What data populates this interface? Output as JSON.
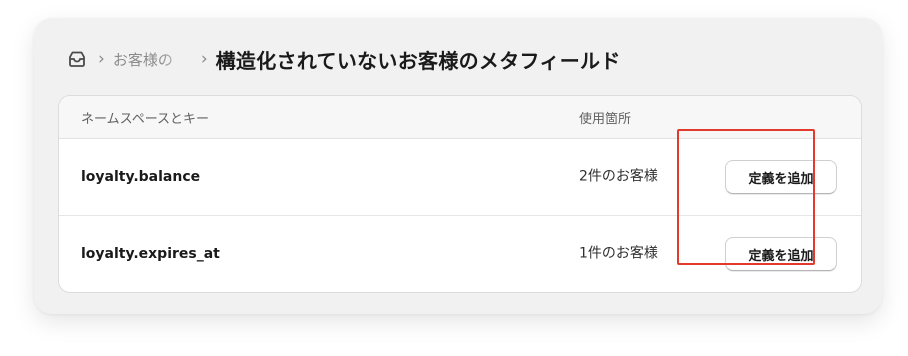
{
  "breadcrumb": {
    "icon": "inbox-tray-icon",
    "parent_label": "お客様の",
    "separator": "›"
  },
  "page": {
    "title": "構造化されていないお客様のメタフィールド"
  },
  "table": {
    "headers": {
      "namespace_key": "ネームスペースとキー",
      "usage": "使用箇所"
    },
    "rows": [
      {
        "namespace_key": "loyalty.balance",
        "usage": "2件のお客様",
        "action_label": "定義を追加"
      },
      {
        "namespace_key": "loyalty.expires_at",
        "usage": "1件のお客様",
        "action_label": "定義を追加"
      }
    ]
  },
  "colors": {
    "highlight": "#e23b2e",
    "frame_background": "#f1f1f1",
    "card_background": "#ffffff",
    "header_background": "#f7f7f7"
  }
}
